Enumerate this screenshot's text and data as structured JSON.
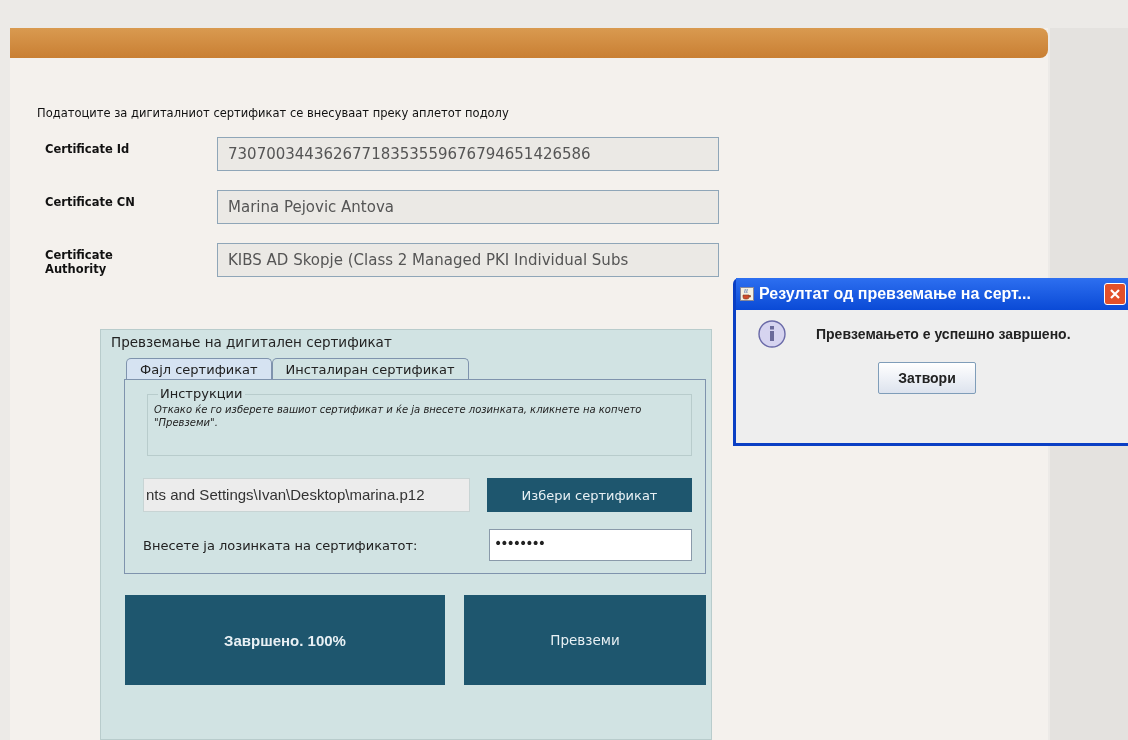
{
  "intro": "Податоците за дигиталниот сертификат се внесуваат преку аплетот подолу",
  "certificate_fields": [
    {
      "label": "Certificate Id",
      "value": "73070034436267718353559676794651426586"
    },
    {
      "label": "Certificate CN",
      "value": "Marina Pejovic Antova"
    },
    {
      "label": "Certificate Authority",
      "value": "KIBS AD Skopje (Class 2 Managed PKI Individual Subs"
    }
  ],
  "applet": {
    "legend": "Превземање на дигитален сертификат",
    "tabs": [
      {
        "label": "Фајл сертификат",
        "selected": true
      },
      {
        "label": "Инсталиран сертификат",
        "selected": false
      }
    ],
    "instructions": {
      "legend": "Инструкции",
      "text": "Откако ќе го изберете вашиот сертификат и ќе ја внесете лозинката, кликнете на копчето \"Превземи\"."
    },
    "file_path": "nts and Settings\\Ivan\\Desktop\\marina.p12",
    "choose_button": "Избери сертификат",
    "password_label": "Внесете ја лозинката на сертификатот:",
    "password_value": "••••••••",
    "progress": {
      "label": "Завршено. 100%",
      "level": 1
    },
    "download_button": "Превземи"
  },
  "dialog": {
    "title": "Резултат од превземање на серт...",
    "message": "Превземањето е успешно завршено.",
    "button": "Затвори"
  }
}
